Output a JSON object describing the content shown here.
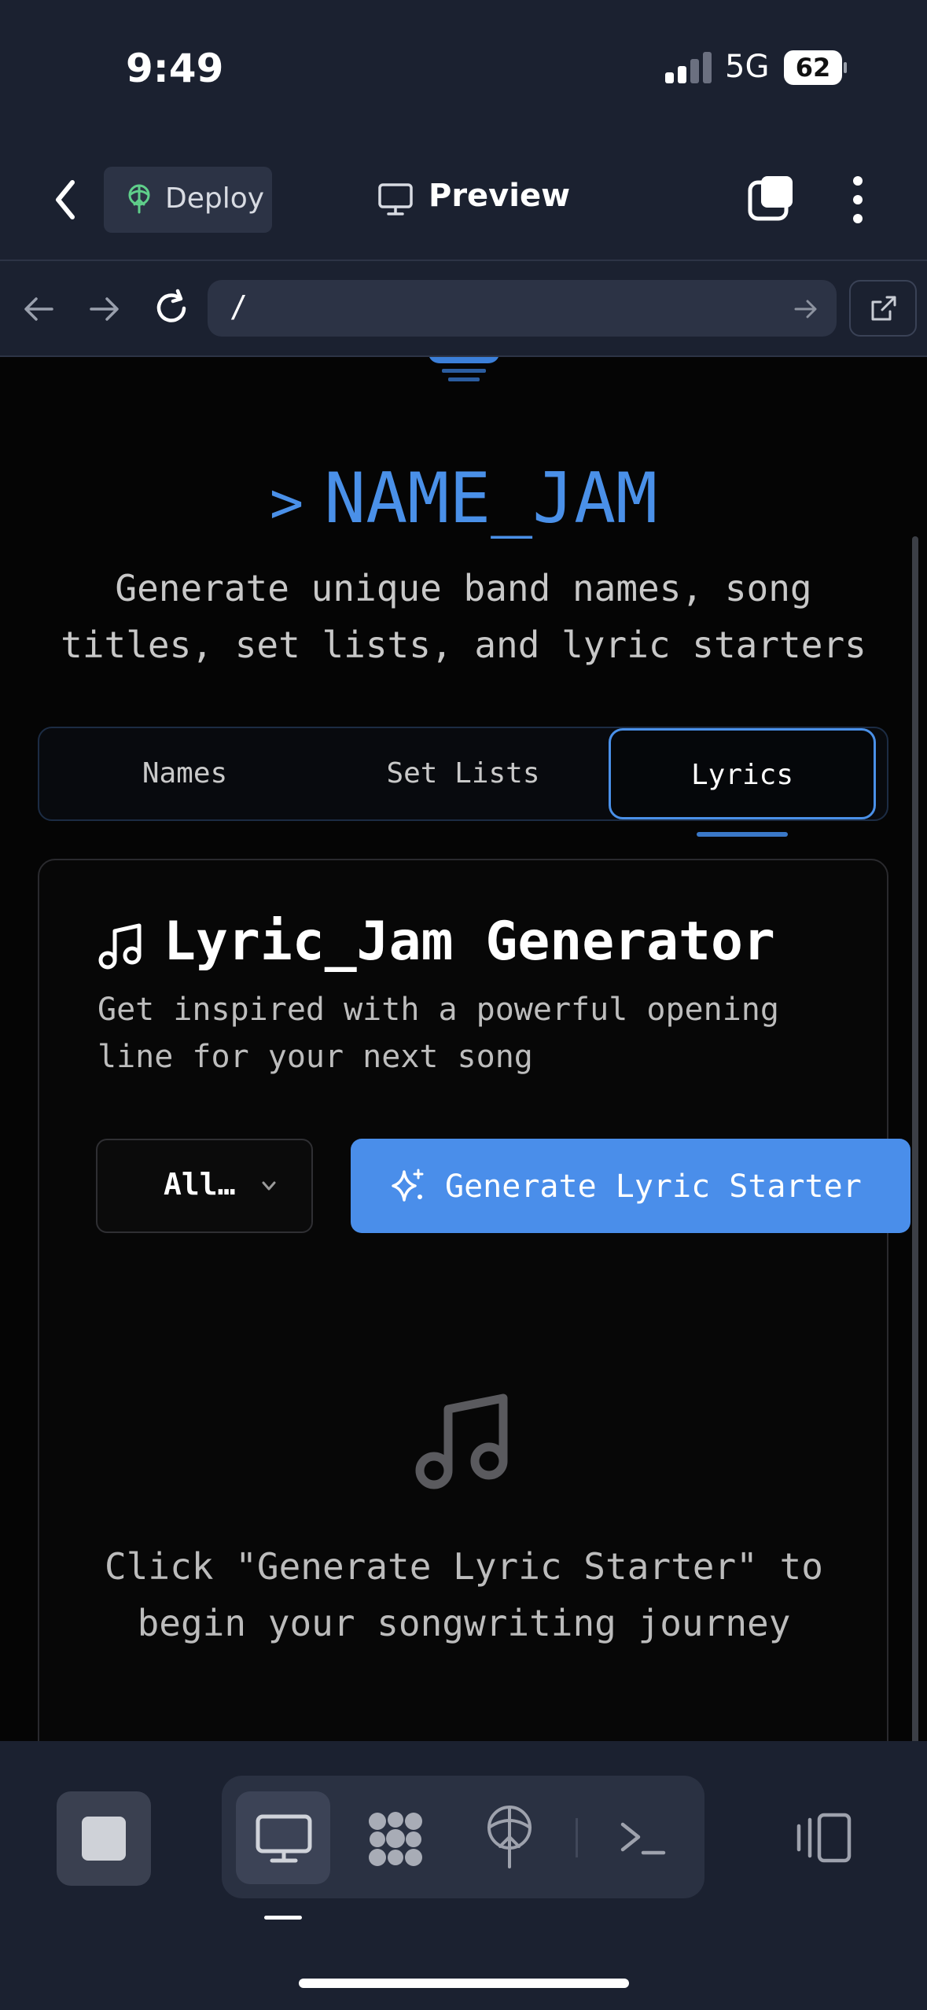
{
  "status_bar": {
    "time": "9:49",
    "network": "5G",
    "battery": "62"
  },
  "header": {
    "deploy_label": "Deploy",
    "preview_label": "Preview"
  },
  "url_bar": {
    "url": "/"
  },
  "page": {
    "title_prompt": ">",
    "title": "NAME_JAM",
    "subtitle_line1": "Generate unique band names, song",
    "subtitle_line2": "titles, set lists, and lyric starters",
    "tabs": [
      {
        "label": "Names"
      },
      {
        "label": "Set Lists"
      },
      {
        "label": "Lyrics"
      }
    ],
    "active_tab": "Lyrics",
    "card": {
      "title": "Lyric_Jam Generator",
      "desc_line1": "Get inspired with a powerful opening",
      "desc_line2": "line for your next song",
      "select_value": "All…",
      "generate_label": "Generate Lyric Starter",
      "empty_line1": "Click \"Generate Lyric Starter\" to",
      "empty_line2": "begin your songwriting journey"
    }
  },
  "colors": {
    "accent": "#4a90e8",
    "toolbar_bg": "#1b2130",
    "page_bg": "#050505"
  },
  "icons": [
    "back-chevron-icon",
    "deploy-icon",
    "monitor-icon",
    "tabs-icon",
    "more-vertical-icon",
    "arrow-left-icon",
    "arrow-right-icon",
    "reload-icon",
    "open-external-icon",
    "music-note-icon",
    "sparkles-icon",
    "chevron-down-icon",
    "stop-icon",
    "desktop-icon",
    "grid-blob-icon",
    "deploy-tree-icon",
    "terminal-icon",
    "side-panel-icon"
  ]
}
